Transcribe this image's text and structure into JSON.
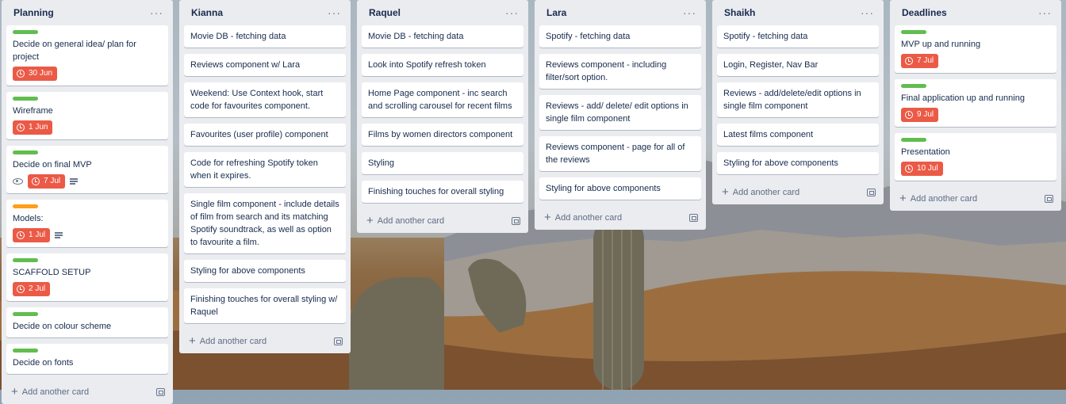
{
  "board": {
    "add_card_label": "Add another card",
    "colors": {
      "label_green": "#61bd4f",
      "label_orange": "#ff9f1a",
      "due_red": "#eb5a46",
      "list_bg": "#ebecf0"
    },
    "lists": [
      {
        "title": "Planning",
        "cards": [
          {
            "text": "Decide on general idea/ plan for project",
            "label": "green",
            "due": "30 Jun"
          },
          {
            "text": "Wireframe",
            "label": "green",
            "due": "1 Jun"
          },
          {
            "text": "Decide on final MVP",
            "label": "green",
            "due": "7 Jul",
            "watch": true,
            "description": true
          },
          {
            "text": "Models:",
            "label": "orange",
            "due": "1 Jul",
            "description": true
          },
          {
            "text": "SCAFFOLD SETUP",
            "label": "green",
            "due": "2 Jul"
          },
          {
            "text": "Decide on colour scheme",
            "label": "green"
          },
          {
            "text": "Decide on fonts",
            "label": "green"
          }
        ]
      },
      {
        "title": "Kianna",
        "cards": [
          {
            "text": "Movie DB - fetching data"
          },
          {
            "text": "Reviews component w/ Lara"
          },
          {
            "text": "Weekend: Use Context hook, start code for favourites component."
          },
          {
            "text": "Favourites (user profile) component"
          },
          {
            "text": "Code for refreshing Spotify token when it expires."
          },
          {
            "text": "Single film component - include details of film from search and its matching Spotify soundtrack, as well as option to favourite a film."
          },
          {
            "text": "Styling for above components"
          },
          {
            "text": "Finishing touches for overall styling w/ Raquel"
          }
        ]
      },
      {
        "title": "Raquel",
        "cards": [
          {
            "text": "Movie DB - fetching data"
          },
          {
            "text": "Look into Spotify refresh token"
          },
          {
            "text": "Home Page component - inc search and scrolling carousel for recent films"
          },
          {
            "text": "Films by women directors component"
          },
          {
            "text": "Styling"
          },
          {
            "text": "Finishing touches for overall styling"
          }
        ]
      },
      {
        "title": "Lara",
        "cards": [
          {
            "text": "Spotify - fetching data"
          },
          {
            "text": "Reviews component - including filter/sort option."
          },
          {
            "text": "Reviews - add/ delete/ edit options in single film component"
          },
          {
            "text": "Reviews component - page for all of the reviews"
          },
          {
            "text": "Styling for above components"
          }
        ]
      },
      {
        "title": "Shaikh",
        "cards": [
          {
            "text": "Spotify - fetching data"
          },
          {
            "text": "Login, Register, Nav Bar"
          },
          {
            "text": "Reviews - add/delete/edit options in single film component"
          },
          {
            "text": "Latest films component"
          },
          {
            "text": "Styling for above components"
          }
        ]
      },
      {
        "title": "Deadlines",
        "cards": [
          {
            "text": "MVP up and running",
            "label": "green",
            "due": "7 Jul"
          },
          {
            "text": "Final application up and running",
            "label": "green",
            "due": "9 Jul"
          },
          {
            "text": "Presentation",
            "label": "green",
            "due": "10 Jul"
          }
        ]
      }
    ]
  }
}
